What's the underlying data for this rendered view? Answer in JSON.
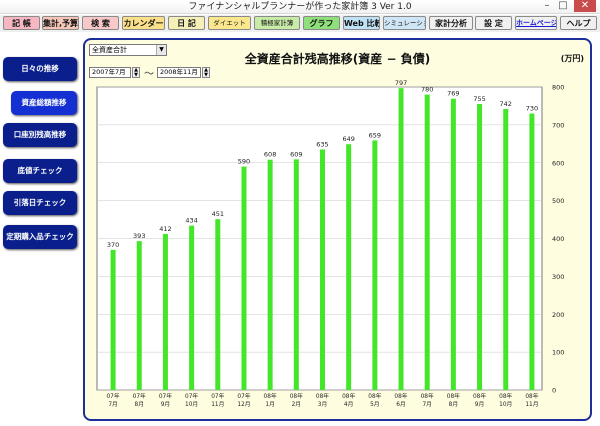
{
  "window": {
    "title": "ファイナンシャルプランナーが作った家計簿 3 Ver 1.0",
    "minimize": "–",
    "maximize": "□",
    "close": "✕"
  },
  "toolbar": [
    {
      "label": "記 帳",
      "color": "#f6b7c3"
    },
    {
      "label": "集計,予算",
      "color": "#f6c7b8"
    },
    {
      "label": "検 索",
      "color": "#f7c9c9"
    },
    {
      "label": "カレンダー",
      "color": "#fbe08a"
    },
    {
      "label": "日 記",
      "color": "#f4f0b8"
    },
    {
      "label": "ダイエット",
      "color": "#fbe88e"
    },
    {
      "label": "積極家計簿",
      "color": "#c9eba8"
    },
    {
      "label": "グラフ",
      "color": "#8fe07a"
    },
    {
      "label": "Web 比較",
      "color": "#bfe2f7"
    },
    {
      "label": "シミュレーション",
      "color": "#cfe6f6"
    },
    {
      "label": "家計分析",
      "color": "#f0f0f0"
    },
    {
      "label": "設 定",
      "color": "#f0f0f0"
    },
    {
      "label": "ホームページ",
      "color": "#f0f0f0"
    },
    {
      "label": "ヘルプ",
      "color": "#f0f0f0"
    }
  ],
  "sidebar": [
    {
      "label": "日々の推移"
    },
    {
      "label": "資産総額推移"
    },
    {
      "label": "口座別残高推移"
    },
    {
      "label": "底値チェック"
    },
    {
      "label": "引落日チェック"
    },
    {
      "label": "定期購入品チェック"
    }
  ],
  "controls": {
    "category": "全資産合計",
    "date_from": "2007年7月",
    "date_to": "2008年11月",
    "tilde": "～"
  },
  "chart_data": {
    "type": "bar",
    "title": "全資産合計残高推移(資産 − 負債)",
    "unit_label": "(万円)",
    "categories": [
      "07年7月",
      "07年8月",
      "07年9月",
      "07年10月",
      "07年11月",
      "07年12月",
      "08年1月",
      "08年2月",
      "08年3月",
      "08年4月",
      "08年5月",
      "08年6月",
      "08年7月",
      "08年8月",
      "08年9月",
      "08年10月",
      "08年11月"
    ],
    "values": [
      370,
      393,
      412,
      434,
      451,
      590,
      608,
      609,
      635,
      649,
      659,
      797,
      780,
      769,
      755,
      742,
      730
    ],
    "ylim": [
      0,
      800
    ],
    "yticks": [
      0,
      100,
      200,
      300,
      400,
      500,
      600,
      700,
      800
    ],
    "axis_side": "right",
    "grid": true,
    "bar_color": "#44e62a"
  }
}
